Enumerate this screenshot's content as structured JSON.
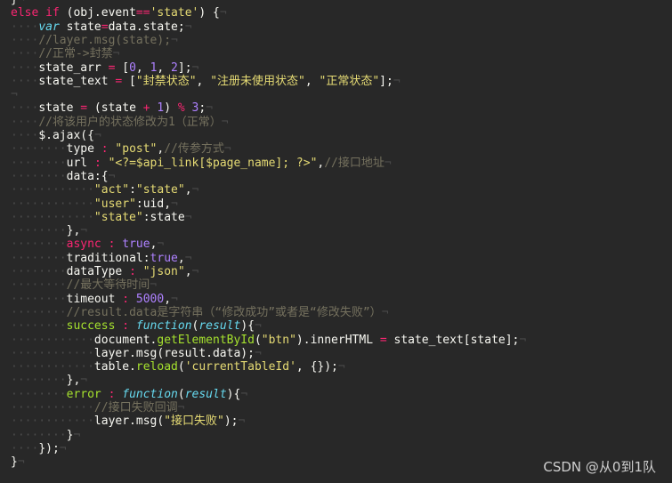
{
  "code_lines": [
    {
      "indent": "}",
      "t": [
        {
          "c": "id",
          "s": ""
        }
      ]
    },
    {
      "t": [
        {
          "c": "kw",
          "s": "else "
        },
        {
          "c": "kw",
          "s": "if "
        },
        {
          "c": "id",
          "s": "(obj.event"
        },
        {
          "c": "op",
          "s": "=="
        },
        {
          "c": "str",
          "s": "'state'"
        },
        {
          "c": "id",
          "s": ") {"
        }
      ]
    },
    {
      "t": [
        {
          "c": "kwi",
          "s": "var "
        },
        {
          "c": "id",
          "s": "state"
        },
        {
          "c": "op",
          "s": "="
        },
        {
          "c": "id",
          "s": "data.state;"
        }
      ]
    },
    {
      "t": [
        {
          "c": "cmt",
          "s": "//layer.msg(state);"
        }
      ]
    },
    {
      "t": [
        {
          "c": "cmt",
          "s": "//正常->封禁"
        }
      ]
    },
    {
      "t": [
        {
          "c": "id",
          "s": "state_arr "
        },
        {
          "c": "op",
          "s": "="
        },
        {
          "c": "id",
          "s": " ["
        },
        {
          "c": "num",
          "s": "0"
        },
        {
          "c": "id",
          "s": ", "
        },
        {
          "c": "num",
          "s": "1"
        },
        {
          "c": "id",
          "s": ", "
        },
        {
          "c": "num",
          "s": "2"
        },
        {
          "c": "id",
          "s": "];"
        }
      ]
    },
    {
      "t": [
        {
          "c": "id",
          "s": "state_text "
        },
        {
          "c": "op",
          "s": "="
        },
        {
          "c": "id",
          "s": " ["
        },
        {
          "c": "str",
          "s": "\"封禁状态\""
        },
        {
          "c": "id",
          "s": ", "
        },
        {
          "c": "str",
          "s": "\"注册未使用状态\""
        },
        {
          "c": "id",
          "s": ", "
        },
        {
          "c": "str",
          "s": "\"正常状态\""
        },
        {
          "c": "id",
          "s": "];"
        }
      ]
    },
    {
      "t": []
    },
    {
      "t": [
        {
          "c": "id",
          "s": "state "
        },
        {
          "c": "op",
          "s": "="
        },
        {
          "c": "id",
          "s": " (state "
        },
        {
          "c": "op",
          "s": "+"
        },
        {
          "c": "id",
          "s": " "
        },
        {
          "c": "num",
          "s": "1"
        },
        {
          "c": "id",
          "s": ") "
        },
        {
          "c": "op",
          "s": "%"
        },
        {
          "c": "id",
          "s": " "
        },
        {
          "c": "num",
          "s": "3"
        },
        {
          "c": "id",
          "s": ";"
        }
      ]
    },
    {
      "t": [
        {
          "c": "cmt",
          "s": "//将该用户的状态修改为1（正常）"
        }
      ]
    },
    {
      "t": [
        {
          "c": "id",
          "s": "$.ajax({"
        }
      ]
    },
    {
      "t": [
        {
          "c": "id",
          "s": "type "
        },
        {
          "c": "op",
          "s": ":"
        },
        {
          "c": "id",
          "s": " "
        },
        {
          "c": "str",
          "s": "\"post\""
        },
        {
          "c": "id",
          "s": ","
        },
        {
          "c": "cmt",
          "s": "//传参方式"
        }
      ]
    },
    {
      "t": [
        {
          "c": "id",
          "s": "url "
        },
        {
          "c": "op",
          "s": ":"
        },
        {
          "c": "id",
          "s": " "
        },
        {
          "c": "str",
          "s": "\"<?=$api_link[$page_name]; ?>\""
        },
        {
          "c": "id",
          "s": ","
        },
        {
          "c": "cmt",
          "s": "//接口地址"
        }
      ]
    },
    {
      "t": [
        {
          "c": "id",
          "s": "data:{"
        }
      ]
    },
    {
      "t": [
        {
          "c": "str",
          "s": "\"act\""
        },
        {
          "c": "id",
          "s": ":"
        },
        {
          "c": "str",
          "s": "\"state\""
        },
        {
          "c": "id",
          "s": ","
        }
      ]
    },
    {
      "t": [
        {
          "c": "str",
          "s": "\"user\""
        },
        {
          "c": "id",
          "s": ":uid,"
        }
      ]
    },
    {
      "t": [
        {
          "c": "str",
          "s": "\"state\""
        },
        {
          "c": "id",
          "s": ":state"
        }
      ]
    },
    {
      "t": [
        {
          "c": "id",
          "s": "},"
        }
      ]
    },
    {
      "t": [
        {
          "c": "kw",
          "s": "async "
        },
        {
          "c": "op",
          "s": ":"
        },
        {
          "c": "id",
          "s": " "
        },
        {
          "c": "num",
          "s": "true"
        },
        {
          "c": "id",
          "s": ","
        }
      ]
    },
    {
      "t": [
        {
          "c": "id",
          "s": "traditional:"
        },
        {
          "c": "num",
          "s": "true"
        },
        {
          "c": "id",
          "s": ","
        }
      ]
    },
    {
      "t": [
        {
          "c": "id",
          "s": "dataType "
        },
        {
          "c": "op",
          "s": ":"
        },
        {
          "c": "id",
          "s": " "
        },
        {
          "c": "str",
          "s": "\"json\""
        },
        {
          "c": "id",
          "s": ","
        }
      ]
    },
    {
      "t": [
        {
          "c": "cmt",
          "s": "//最大等待时间"
        }
      ]
    },
    {
      "t": [
        {
          "c": "id",
          "s": "timeout "
        },
        {
          "c": "op",
          "s": ":"
        },
        {
          "c": "id",
          "s": " "
        },
        {
          "c": "num",
          "s": "5000"
        },
        {
          "c": "id",
          "s": ","
        }
      ]
    },
    {
      "t": [
        {
          "c": "cmt",
          "s": "//result.data是字符串（“修改成功”或者是“修改失败”）"
        }
      ]
    },
    {
      "t": [
        {
          "c": "fn",
          "s": "success "
        },
        {
          "c": "op",
          "s": ":"
        },
        {
          "c": "id",
          "s": " "
        },
        {
          "c": "kwi",
          "s": "function"
        },
        {
          "c": "id",
          "s": "("
        },
        {
          "c": "kwi",
          "s": "result"
        },
        {
          "c": "id",
          "s": "){"
        }
      ]
    },
    {
      "t": [
        {
          "c": "id",
          "s": "document."
        },
        {
          "c": "fn",
          "s": "getElementById"
        },
        {
          "c": "id",
          "s": "("
        },
        {
          "c": "str",
          "s": "\"btn\""
        },
        {
          "c": "id",
          "s": ").innerHTML "
        },
        {
          "c": "op",
          "s": "="
        },
        {
          "c": "id",
          "s": " state_text[state];"
        }
      ]
    },
    {
      "t": [
        {
          "c": "id",
          "s": "layer.msg(result.data);"
        }
      ]
    },
    {
      "t": [
        {
          "c": "id",
          "s": "table."
        },
        {
          "c": "fn",
          "s": "reload"
        },
        {
          "c": "id",
          "s": "("
        },
        {
          "c": "str",
          "s": "'currentTableId'"
        },
        {
          "c": "id",
          "s": ", {});"
        }
      ]
    },
    {
      "t": [
        {
          "c": "id",
          "s": "},"
        }
      ]
    },
    {
      "t": [
        {
          "c": "fn",
          "s": "error "
        },
        {
          "c": "op",
          "s": ":"
        },
        {
          "c": "id",
          "s": " "
        },
        {
          "c": "kwi",
          "s": "function"
        },
        {
          "c": "id",
          "s": "("
        },
        {
          "c": "kwi",
          "s": "result"
        },
        {
          "c": "id",
          "s": "){"
        }
      ]
    },
    {
      "t": [
        {
          "c": "cmt",
          "s": "//接口失败回调"
        }
      ]
    },
    {
      "t": [
        {
          "c": "id",
          "s": "layer.msg("
        },
        {
          "c": "str",
          "s": "\"接口失败\""
        },
        {
          "c": "id",
          "s": ");"
        }
      ]
    },
    {
      "t": [
        {
          "c": "id",
          "s": "}"
        }
      ]
    },
    {
      "t": [
        {
          "c": "id",
          "s": "});"
        }
      ]
    },
    {
      "t": [
        {
          "c": "id",
          "s": "}"
        }
      ]
    }
  ],
  "watermark": "CSDN @从0到1队",
  "colors": {
    "background": "#282828",
    "keyword": "#f92672",
    "string": "#e6db74",
    "number": "#ae81ff",
    "comment": "#75715e",
    "function": "#a6e22e",
    "storage": "#66d9ef"
  }
}
